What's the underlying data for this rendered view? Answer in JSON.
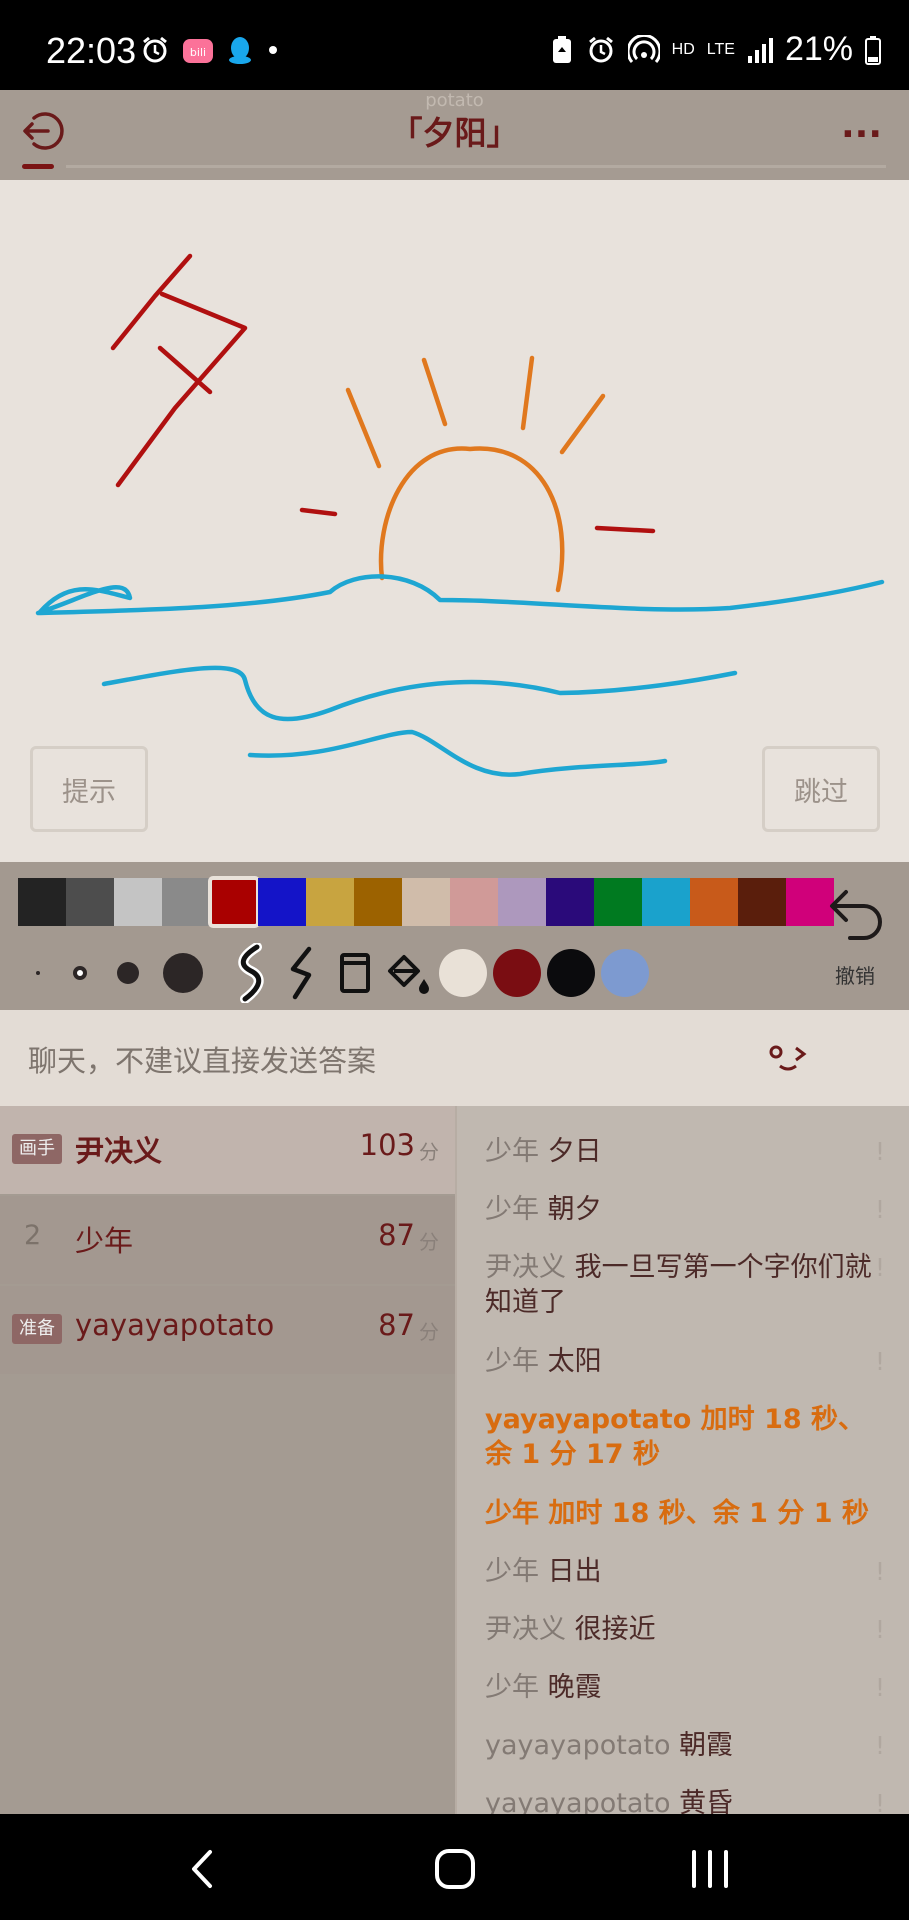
{
  "status_bar": {
    "time": "22:03",
    "battery": "21%",
    "net_hd": "HD",
    "net_lte": "LTE",
    "left_icons": [
      "alarm-icon",
      "bilibili-icon",
      "qq-icon",
      "dot-icon"
    ],
    "right_icons": [
      "battery-saver-icon",
      "alarm-icon",
      "hotspot-icon",
      "hd-icon",
      "lte-icon",
      "signal-icon",
      "battery-icon"
    ]
  },
  "header": {
    "subtitle": "potato",
    "title": "「夕阳」",
    "more_label": "..."
  },
  "canvas": {
    "hint_label": "提示",
    "skip_label": "跳过"
  },
  "toolbar": {
    "palette": [
      "#232323",
      "#4d4d4d",
      "#c4c4c4",
      "#8a8a8a",
      "#a90000",
      "#1414c8",
      "#c8a440",
      "#9c6200",
      "#d0bcaa",
      "#d09a98",
      "#ad98bd",
      "#2a0a7a",
      "#007a20",
      "#1aa2cc",
      "#c85a1a",
      "#5a1e0c",
      "#d0007a"
    ],
    "selected_color": "#a90000",
    "undo_label": "撤销",
    "brush_sizes": [
      "tiny",
      "small",
      "medium",
      "large"
    ],
    "tools": [
      "brush-smooth",
      "brush-rough",
      "eraser",
      "fill-bucket"
    ],
    "recent_colors": [
      "#e9e1d7",
      "#7a0d12",
      "#0b0b0d",
      "#7d9ad0"
    ]
  },
  "chat": {
    "placeholder": "聊天，不建议直接发送答案",
    "emoji": "°ᴗ°"
  },
  "players": [
    {
      "badge": "画手",
      "rank": "",
      "name": "尹决义",
      "score": "103",
      "unit": "分",
      "role": "drawer"
    },
    {
      "badge": "",
      "rank": "2",
      "name": "少年",
      "score": "87",
      "unit": "分",
      "role": "guesser"
    },
    {
      "badge": "准备",
      "rank": "",
      "name": "yayayapotato",
      "score": "87",
      "unit": "分",
      "role": "ready"
    }
  ],
  "messages": [
    {
      "who": "少年",
      "text": "夕日",
      "mark": "!",
      "system": false
    },
    {
      "who": "少年",
      "text": "朝夕",
      "mark": "!",
      "system": false
    },
    {
      "who": "尹决义",
      "text": "我一旦写第一个字你们就知道了",
      "mark": "!",
      "system": false
    },
    {
      "who": "少年",
      "text": "太阳",
      "mark": "!",
      "system": false
    },
    {
      "who": "yayayapotato",
      "text": "加时 18 秒、余 1 分 17 秒",
      "mark": "",
      "system": true
    },
    {
      "who": "少年",
      "text": "加时 18 秒、余 1 分 1 秒",
      "mark": "",
      "system": true
    },
    {
      "who": "少年",
      "text": "日出",
      "mark": "!",
      "system": false
    },
    {
      "who": "尹决义",
      "text": "很接近",
      "mark": "!",
      "system": false
    },
    {
      "who": "少年",
      "text": "晚霞",
      "mark": "!",
      "system": false
    },
    {
      "who": "yayayapotato",
      "text": "朝霞",
      "mark": "!",
      "system": false
    },
    {
      "who": "yayayapotato",
      "text": "黄昏",
      "mark": "!",
      "system": false
    }
  ]
}
